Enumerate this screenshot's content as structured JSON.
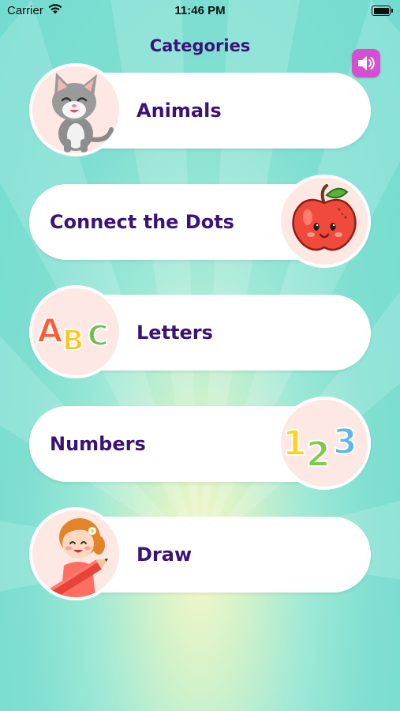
{
  "status_bar": {
    "carrier": "Carrier",
    "time": "11:46 PM"
  },
  "header": {
    "title": "Categories"
  },
  "sound_button": {
    "icon": "speaker-icon",
    "color": "#d64fd1"
  },
  "categories": [
    {
      "label": "Animals",
      "icon": "cat-icon"
    },
    {
      "label": "Connect the Dots",
      "icon": "apple-icon"
    },
    {
      "label": "Letters",
      "icon": "abc-letters-icon"
    },
    {
      "label": "Numbers",
      "icon": "numbers-123-icon"
    },
    {
      "label": "Draw",
      "icon": "girl-with-pencil-icon"
    }
  ],
  "colors": {
    "label_text": "#3a1278",
    "card_background": "#ffffff",
    "icon_circle_background": "#fde8e3",
    "background": "#7fdfd1"
  }
}
